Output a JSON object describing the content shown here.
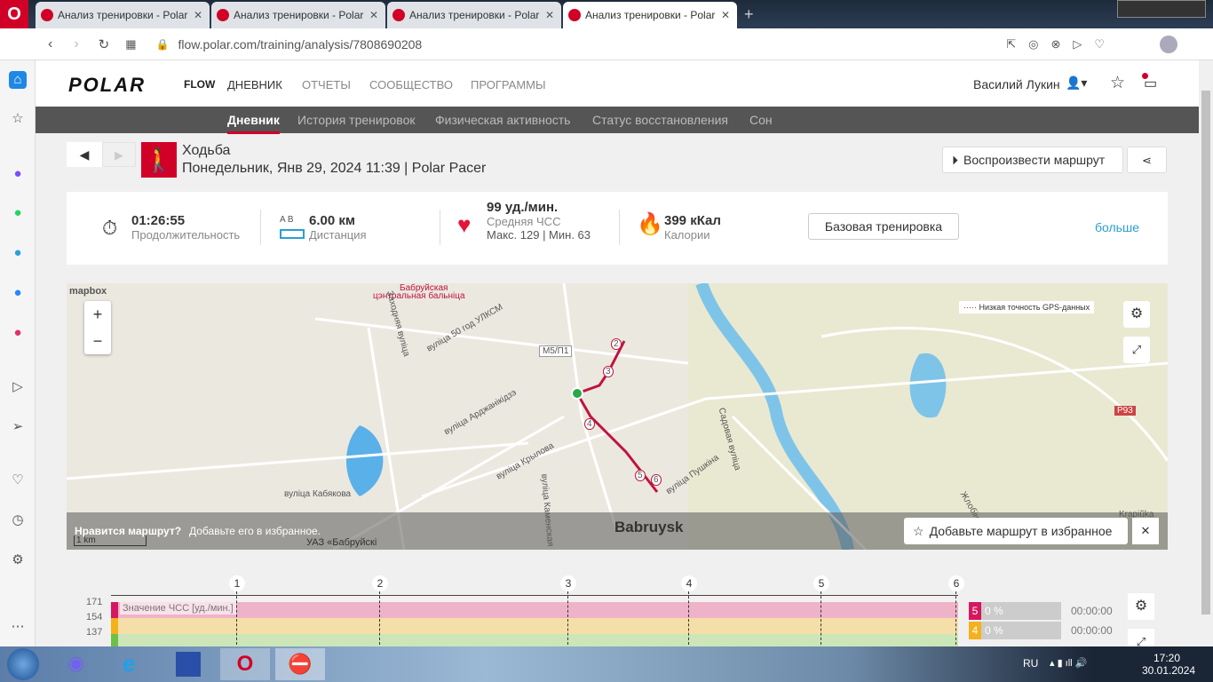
{
  "browser": {
    "tabs": [
      "Анализ тренировки - Polar",
      "Анализ тренировки - Polar",
      "Анализ тренировки - Polar",
      "Анализ тренировки - Polar"
    ],
    "url": "flow.polar.com/training/analysis/7808690208"
  },
  "header": {
    "logo": "POLAR",
    "flow": "FLOW",
    "nav": [
      "ДНЕВНИК",
      "ОТЧЕТЫ",
      "СООБЩЕСТВО",
      "ПРОГРАММЫ"
    ],
    "user": "Василий Лукин"
  },
  "subnav": [
    "Дневник",
    "История тренировок",
    "Физическая активность",
    "Статус восстановления",
    "Сон"
  ],
  "session": {
    "sport": "Ходьба",
    "date": "Понедельник, Янв 29, 2024 11:39 | Polar Pacer",
    "replay": "Воспроизвести маршрут"
  },
  "summary": {
    "duration": "01:26:55",
    "duration_label": "Продолжительность",
    "dist_ab": "A   B",
    "distance": "6.00 км",
    "distance_label": "Дистанция",
    "hr": "99 уд./мин.",
    "hr_label": "Средняя ЧСС",
    "hr_minmax": "Макс. 129 | Мин. 63",
    "calories": "399 кКал",
    "calories_label": "Калории",
    "base": "Базовая тренировка",
    "more": "больше"
  },
  "map": {
    "attribution": "mapbox",
    "legend": "Низкая точность GPS-данных",
    "zoom_in": "+",
    "zoom_out": "−",
    "scale": "1 km",
    "city": "Babruysk",
    "labels": [
      "Бабруйская",
      "цэнтральная бальніца",
      "Заходняя вуліца",
      "вуліца 50 год УЛКСМ",
      "M5/П1",
      "вуліца Арджанікідзэ",
      "вуліца Крылова",
      "вуліца Кабякова",
      "вуліца Каменская",
      "вуліца Пушкіна",
      "Садовая вуліца",
      "УАЗ «Бабруйскі",
      "Р93",
      "Жлобін",
      "Krapiŭka"
    ],
    "km_markers": [
      "2",
      "3",
      "4",
      "5",
      "6"
    ],
    "promo_q": "Нравится маршрут?",
    "promo_t": "Добавьте его в избранное.",
    "fav": "Добавьте маршрут в избранное"
  },
  "chart": {
    "km": [
      "1",
      "2",
      "3",
      "4",
      "5",
      "6"
    ],
    "y": [
      "171",
      "154",
      "137"
    ],
    "series_label": "Значение ЧСС [уд./мин.]",
    "zones": [
      {
        "n": "5",
        "pct": "0 %",
        "time": "00:00:00",
        "color": "#d6175f"
      },
      {
        "n": "4",
        "pct": "0 %",
        "time": "00:00:00",
        "color": "#f5b11c"
      }
    ]
  },
  "taskbar": {
    "lang": "RU",
    "time": "17:20",
    "date": "30.01.2024"
  }
}
